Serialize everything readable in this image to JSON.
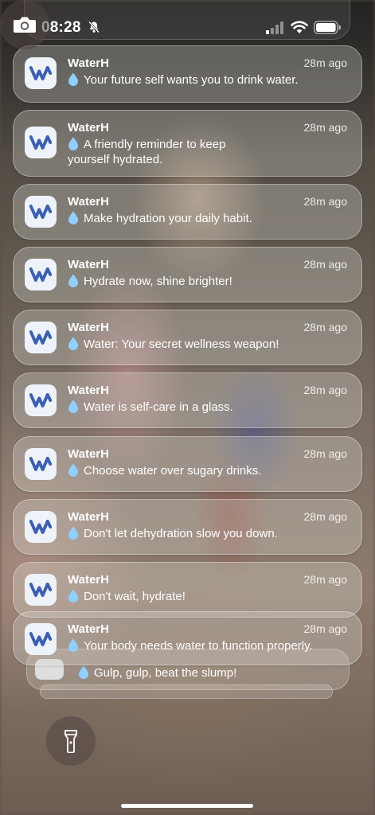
{
  "status_bar": {
    "time": "08:28"
  },
  "app": {
    "name": "WaterH"
  },
  "notifications": [
    {
      "app": "WaterH",
      "time": "28m ago",
      "message": "Your future self wants you to drink water."
    },
    {
      "app": "WaterH",
      "time": "28m ago",
      "message": "A friendly reminder to keep yourself hydrated."
    },
    {
      "app": "WaterH",
      "time": "28m ago",
      "message": "Make hydration your daily habit."
    },
    {
      "app": "WaterH",
      "time": "28m ago",
      "message": "Hydrate now, shine brighter!"
    },
    {
      "app": "WaterH",
      "time": "28m ago",
      "message": "Water: Your secret wellness weapon!"
    },
    {
      "app": "WaterH",
      "time": "28m ago",
      "message": "Water is self-care in a glass."
    },
    {
      "app": "WaterH",
      "time": "28m ago",
      "message": "Choose water over sugary drinks."
    },
    {
      "app": "WaterH",
      "time": "28m ago",
      "message": "Don't let dehydration slow you down."
    },
    {
      "app": "WaterH",
      "time": "28m ago",
      "message": "Don't wait, hydrate!"
    },
    {
      "app": "WaterH",
      "time": "28m ago",
      "message": "Your body needs water to function properly."
    }
  ],
  "stacked_notification": {
    "message": "Gulp, gulp, beat the slump!"
  },
  "icons": {
    "app_icon": "waterh-logo-icon",
    "drop": "water-drop-icon",
    "flashlight": "flashlight-icon",
    "camera": "camera-icon"
  }
}
